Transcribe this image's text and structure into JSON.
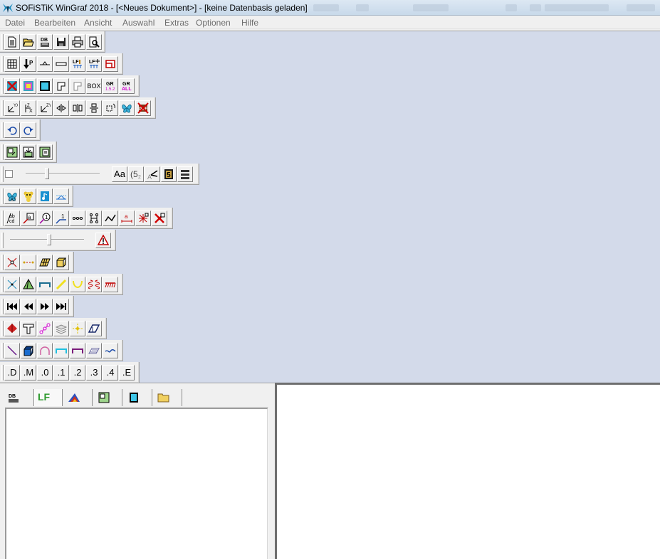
{
  "window": {
    "title": "SOFiSTiK WinGraf 2018 - [<Neues Dokument>] - [keine Datenbasis geladen]"
  },
  "menu": [
    "Datei",
    "Bearbeiten",
    "Ansicht",
    "Auswahl",
    "Extras",
    "Optionen",
    "Hilfe"
  ],
  "toolbars": {
    "text_label_size": "Aa",
    "number_button": ".D",
    "number_buttons": [
      ".D",
      ".M",
      ".0",
      ".1",
      ".2",
      ".3",
      ".4",
      ".E"
    ],
    "box_label": "BOX",
    "gr_labels": [
      "GR 1.5.2",
      "GR ALL"
    ]
  },
  "panel_tabs": {
    "lf_label": "LF"
  },
  "colors": {
    "workspace": "#d3daea",
    "toolbar": "#f0f0f0",
    "menu_text": "#6d6d6d"
  }
}
